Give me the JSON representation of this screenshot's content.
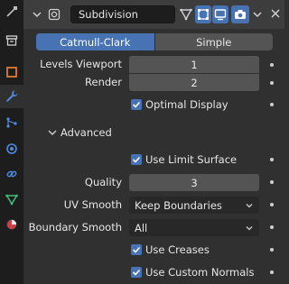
{
  "modifier": {
    "name": "Subdivision",
    "icons": [
      "chevron-down-icon",
      "wrench-modifier-icon",
      "vertex-funnel-icon",
      "edit-mode-icon",
      "realtime-display-icon",
      "render-camera-icon",
      "dropdown-chevron-icon",
      "close-icon"
    ]
  },
  "sidebar": {
    "tabs": [
      "tool-icon",
      "scene-icon",
      "object-icon",
      "modifier-wrench-icon",
      "particles-icon",
      "physics-icon",
      "constraints-icon",
      "object-data-icon",
      "material-icon"
    ],
    "active_tab": "modifier-wrench-icon"
  },
  "subdivision_type": {
    "options": [
      "Catmull-Clark",
      "Simple"
    ],
    "selected": "Catmull-Clark"
  },
  "levels_viewport": {
    "label": "Levels Viewport",
    "value": "1"
  },
  "render": {
    "label": "Render",
    "value": "2"
  },
  "optimal_display": {
    "label": "Optimal Display",
    "checked": true
  },
  "advanced": {
    "title": "Advanced",
    "use_limit_surface": {
      "label": "Use Limit Surface",
      "checked": true
    },
    "quality": {
      "label": "Quality",
      "value": "3"
    },
    "uv_smooth": {
      "label": "UV Smooth",
      "value": "Keep Boundaries"
    },
    "boundary_smooth": {
      "label": "Boundary Smooth",
      "value": "All"
    },
    "use_creases": {
      "label": "Use Creases",
      "checked": true
    },
    "use_custom_normals": {
      "label": "Use Custom Normals",
      "checked": true
    }
  },
  "colors": {
    "accent": "#4772b3",
    "panel_bg": "#303030",
    "field_bg": "#545454",
    "dropdown_bg": "#282828",
    "strip_bg": "#1d1d1d"
  }
}
